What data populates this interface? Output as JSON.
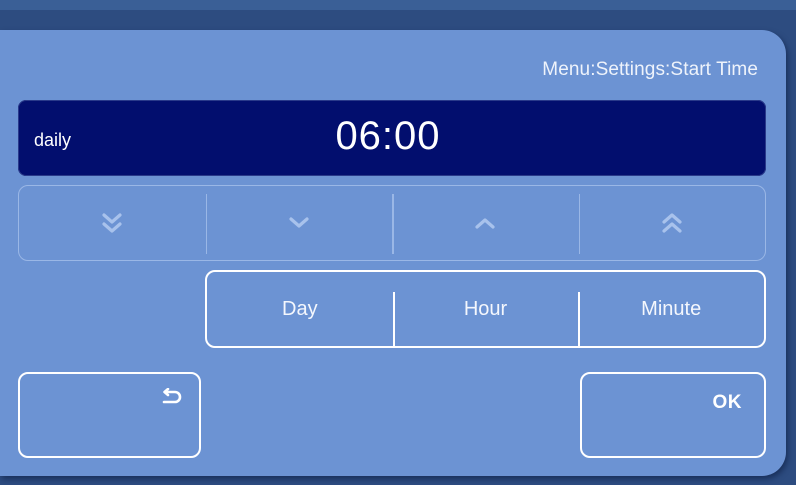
{
  "header": {
    "breadcrumb": "Menu:Settings:Start Time"
  },
  "display": {
    "mode": "daily",
    "time": "06:00"
  },
  "adjust_buttons": [
    {
      "name": "fast-decrease",
      "icon": "double-chevron-down-icon"
    },
    {
      "name": "decrease",
      "icon": "chevron-down-icon"
    },
    {
      "name": "increase",
      "icon": "chevron-up-icon"
    },
    {
      "name": "fast-increase",
      "icon": "double-chevron-up-icon"
    }
  ],
  "units": {
    "day": "Day",
    "hour": "Hour",
    "minute": "Minute"
  },
  "footer": {
    "back_icon": "return-arrow-icon",
    "ok_label": "OK"
  },
  "colors": {
    "panel": "#6c93d3",
    "display_bg": "#020e6e",
    "background": "#2d4c80"
  }
}
